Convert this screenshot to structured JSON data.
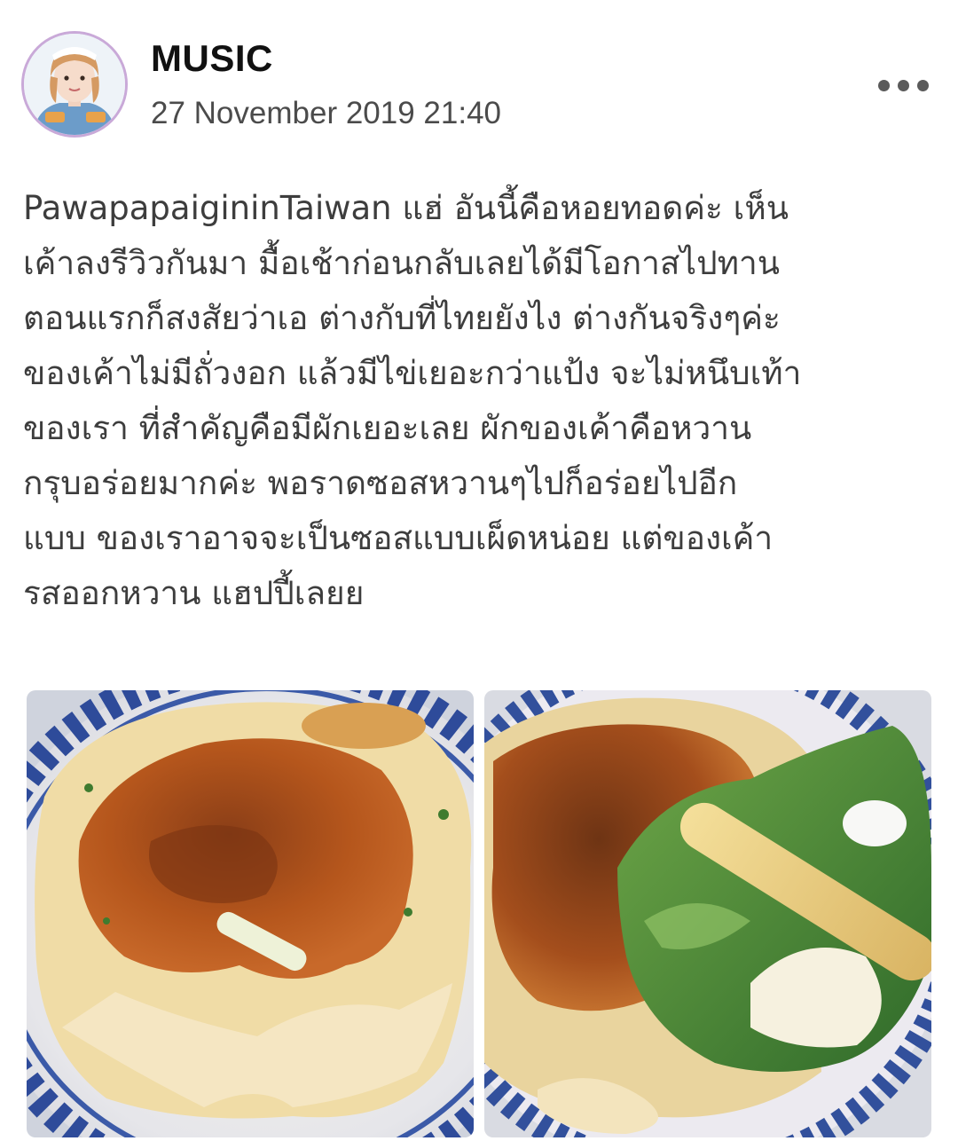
{
  "post": {
    "author": "MUSIC",
    "timestamp": "27 November 2019 21:40",
    "text_lines": [
      "PawapapaigininTaiwan แฮ่ อันนี้คือหอยทอดค่ะ เห็น",
      "เค้าลงรีวิวกันมา มื้อเช้าก่อนกลับเลยได้มีโอกาสไปทาน",
      "ตอนแรกก็สงสัยว่าเอ ต่างกับที่ไทยยังไง ต่างกันจริงๆค่ะ",
      "ของเค้าไม่มีถั่วงอก แล้วมีไข่เยอะกว่าแป้ง จะไม่หนึบเท้า",
      "ของเรา ที่สำคัญคือมีผักเยอะเลย ผักของเค้าคือหวาน",
      "กรุบอร่อยมากค่ะ  พอราดซอสหวานๆไปก็อร่อยไปอีก",
      "แบบ ของเราอาจจะเป็นซอสแบบเผ็ดหน่อย แต่ของเค้า",
      "รสออกหวาน แฮปปี้เลยย"
    ],
    "icons": {
      "more": "more-options-icon"
    },
    "colors": {
      "avatar_ring": "#c9a9d8",
      "text": "#3d3d3d",
      "author": "#111111"
    }
  }
}
